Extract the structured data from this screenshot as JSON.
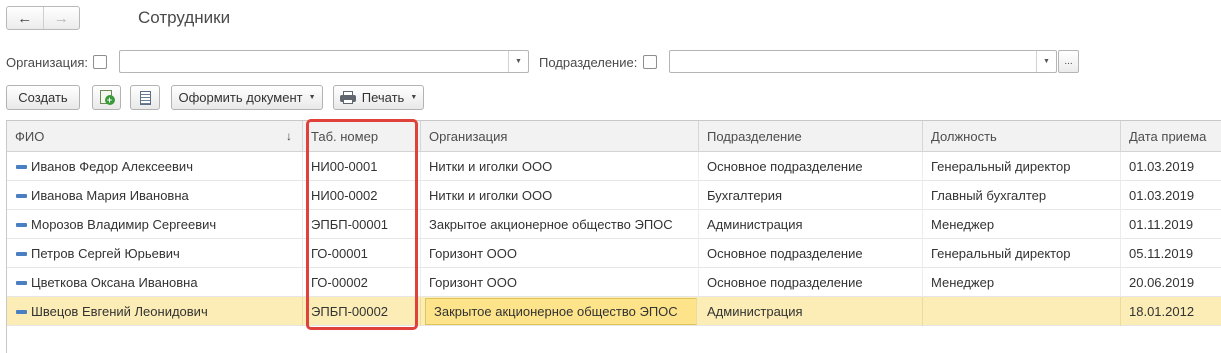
{
  "header": {
    "title": "Сотрудники",
    "back_icon": "←",
    "forward_icon": "→"
  },
  "filters": {
    "organization_label": "Организация:",
    "organization_value": "",
    "department_label": "Подразделение:",
    "department_value": "",
    "ellipsis": "..."
  },
  "toolbar": {
    "create_label": "Создать",
    "make_document_label": "Оформить документ",
    "print_label": "Печать",
    "caret": "▼"
  },
  "table": {
    "columns": [
      "ФИО",
      "Таб. номер",
      "Организация",
      "Подразделение",
      "Должность",
      "Дата приема"
    ],
    "sort_indicator": "↓",
    "rows": [
      {
        "name": "Иванов Федор Алексеевич",
        "tab": "НИ00-0001",
        "org": "Нитки и иголки ООО",
        "dept": "Основное подразделение",
        "pos": "Генеральный директор",
        "date": "01.03.2019"
      },
      {
        "name": "Иванова Мария Ивановна",
        "tab": "НИ00-0002",
        "org": "Нитки и иголки ООО",
        "dept": "Бухгалтерия",
        "pos": "Главный бухгалтер",
        "date": "01.03.2019"
      },
      {
        "name": "Морозов Владимир Сергеевич",
        "tab": "ЭПБП-00001",
        "org": "Закрытое акционерное общество ЭПОС",
        "dept": "Администрация",
        "pos": "Менеджер",
        "date": "01.11.2019"
      },
      {
        "name": "Петров Сергей Юрьевич",
        "tab": "ГО-00001",
        "org": "Горизонт ООО",
        "dept": "Основное подразделение",
        "pos": "Генеральный директор",
        "date": "05.11.2019"
      },
      {
        "name": "Цветкова Оксана Ивановна",
        "tab": "ГО-00002",
        "org": "Горизонт ООО",
        "dept": "Основное подразделение",
        "pos": "Менеджер",
        "date": "20.06.2019"
      },
      {
        "name": "Швецов Евгений Леонидович",
        "tab": "ЭПБП-00002",
        "org": "Закрытое акционерное общество ЭПОС",
        "dept": "Администрация",
        "pos": "",
        "date": "18.01.2012"
      }
    ],
    "selected_row": 5
  },
  "colors": {
    "highlight": "#e0413a",
    "selected_row": "#fbedb5",
    "current_cell": "#fde48a"
  }
}
